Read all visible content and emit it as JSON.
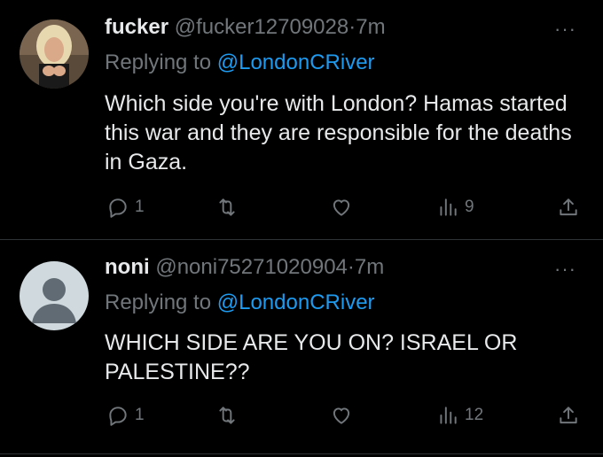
{
  "tweets": [
    {
      "name": "fucker",
      "handle": "@fucker12709028",
      "dot": "·",
      "time": "7m",
      "replying_prefix": "Replying to ",
      "replying_to": "@LondonCRiver",
      "text": "Which side you're with London?  Hamas started this war and they are responsible for the deaths in Gaza.",
      "reply_count": "1",
      "views": "9",
      "more": "···"
    },
    {
      "name": "noni",
      "handle": "@noni75271020904",
      "dot": "·",
      "time": "7m",
      "replying_prefix": "Replying to ",
      "replying_to": "@LondonCRiver",
      "text": "WHICH SIDE ARE YOU ON? ISRAEL OR PALESTINE??",
      "reply_count": "1",
      "views": "12",
      "more": "···"
    }
  ],
  "colors": {
    "background": "#000000",
    "text": "#e7e9ea",
    "muted": "#71767b",
    "link": "#1d9bf0",
    "divider": "#2f3336"
  }
}
